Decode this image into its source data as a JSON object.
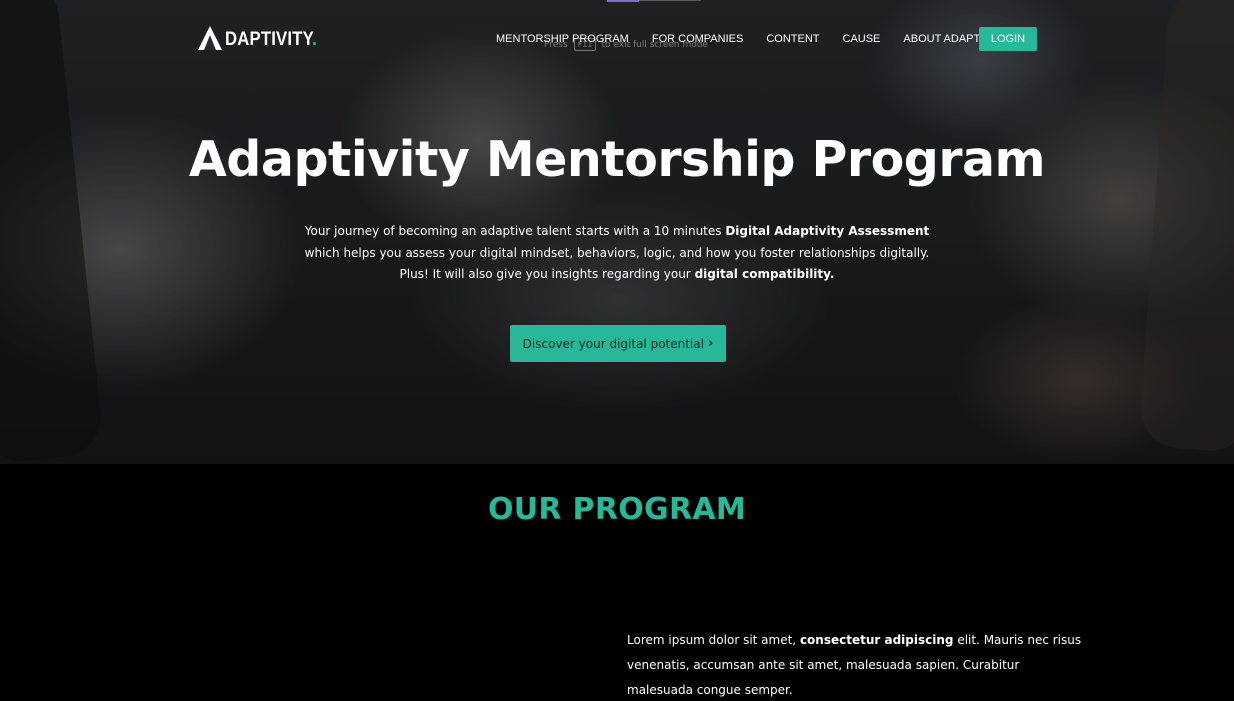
{
  "brand": {
    "logo_text": "DAPTIVITY",
    "logo_dot": ".",
    "accent_color": "#26b899"
  },
  "nav": {
    "items": [
      "MENTORSHIP PROGRAM",
      "FOR COMPANIES",
      "CONTENT",
      "CAUSE",
      "ABOUT ADAPTABILITY"
    ],
    "login_label": "LOGIN"
  },
  "fullscreen_hint": {
    "before": "Press",
    "key": "F11",
    "after": "to exit full screen mode"
  },
  "hero": {
    "title": "Adaptivity Mentorship Program",
    "line1_text": "Your journey of becoming an adaptive talent starts with a 10 minutes ",
    "line1_bold": "Digital Adaptivity Assessment",
    "line2_text": "which helps you assess your digital mindset, behaviors, logic, and how you foster relationships digitally.",
    "line3_text": "Plus! It will also give you insights regarding your ",
    "line3_bold": "digital compatibility.",
    "cta_label": "Discover your digital potential",
    "cta_icon": "chevron-right-icon"
  },
  "program": {
    "title": "OUR PROGRAM",
    "para_start": "Lorem ipsum dolor sit amet, ",
    "para_bold": "consectetur adipiscing",
    "para_end": " elit. Mauris nec risus venenatis, accumsan ante sit amet, malesuada sapien. Curabitur malesuada congue semper."
  }
}
